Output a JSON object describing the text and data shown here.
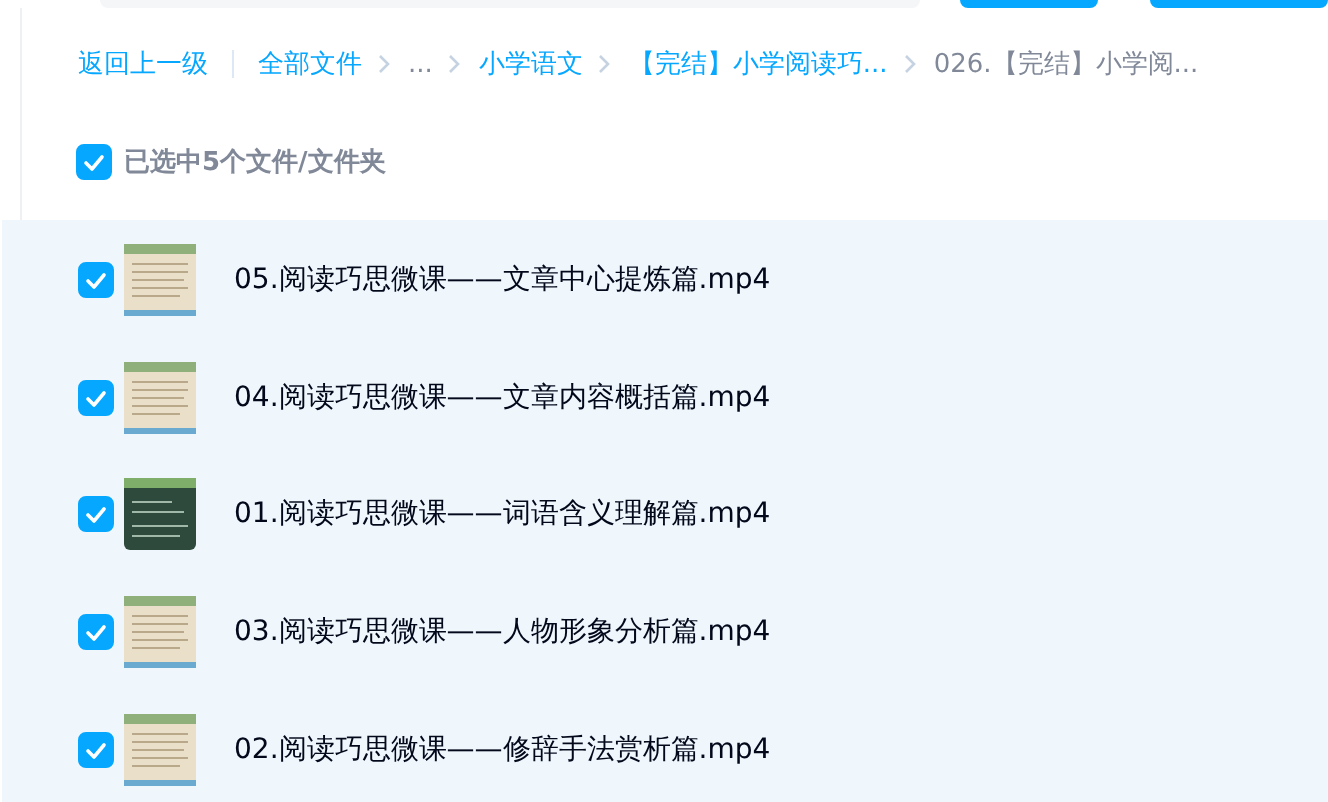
{
  "breadcrumb": {
    "back": "返回上一级",
    "items": [
      {
        "label": "全部文件",
        "kind": "link"
      },
      {
        "label": "...",
        "kind": "ellipsis"
      },
      {
        "label": "小学语文",
        "kind": "link"
      },
      {
        "label": "【完结】小学阅读巧...",
        "kind": "link"
      },
      {
        "label": "026.【完结】小学阅...",
        "kind": "current"
      }
    ]
  },
  "selection": {
    "checked": true,
    "label": "已选中5个文件/文件夹"
  },
  "files": [
    {
      "name": "05.阅读巧思微课——文章中心提炼篇.mp4",
      "checked": true,
      "kind": "paper"
    },
    {
      "name": "04.阅读巧思微课——文章内容概括篇.mp4",
      "checked": true,
      "kind": "paper"
    },
    {
      "name": "01.阅读巧思微课——词语含义理解篇.mp4",
      "checked": true,
      "kind": "board"
    },
    {
      "name": "03.阅读巧思微课——人物形象分析篇.mp4",
      "checked": true,
      "kind": "paper"
    },
    {
      "name": "02.阅读巧思微课——修辞手法赏析篇.mp4",
      "checked": true,
      "kind": "paper"
    }
  ]
}
